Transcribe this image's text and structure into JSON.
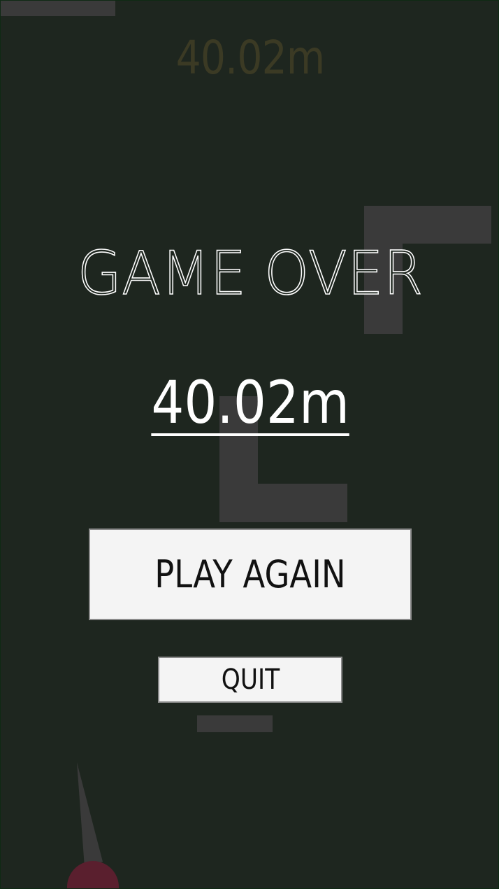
{
  "hud": {
    "distance": "40.02m"
  },
  "game_over": {
    "title": "GAME OVER",
    "final_distance": "40.02m"
  },
  "buttons": {
    "play_again_label": "PLAY AGAIN",
    "quit_label": "QUIT"
  },
  "colors": {
    "background": "#1e261f",
    "obstacle": "#3a3a3a",
    "hud_text": "#3b3a24",
    "button_fill": "#f4f4f4",
    "player": "#5a1f2e"
  }
}
